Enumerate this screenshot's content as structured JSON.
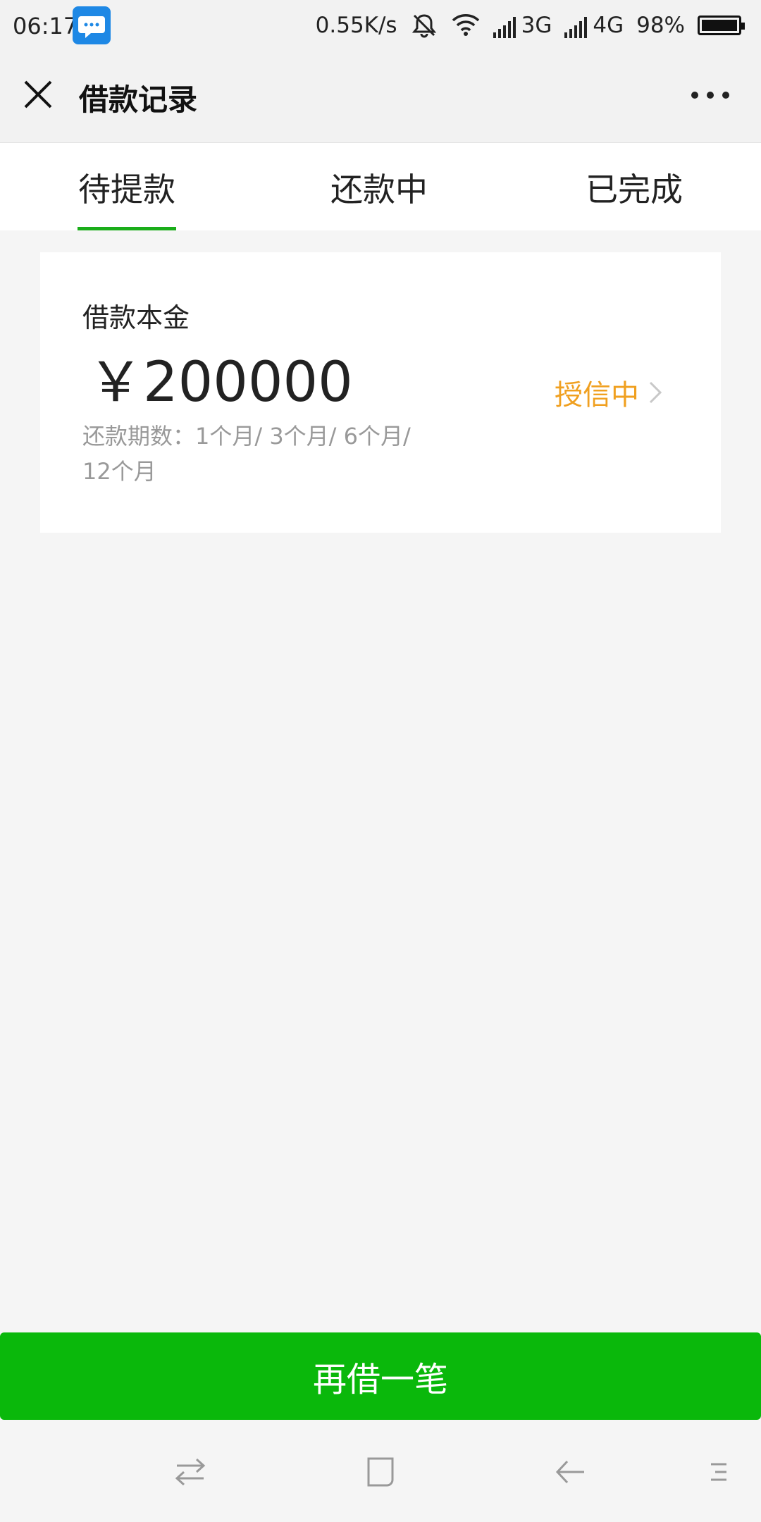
{
  "status_bar": {
    "time": "06:17",
    "speed": "0.55K/s",
    "network_3g": "3G",
    "network_4g": "4G",
    "battery": "98%"
  },
  "title_bar": {
    "title": "借款记录"
  },
  "tabs": [
    {
      "label": "待提款",
      "active": true
    },
    {
      "label": "还款中",
      "active": false
    },
    {
      "label": "已完成",
      "active": false
    }
  ],
  "loan_card": {
    "label": "借款本金",
    "amount": "￥200000",
    "terms_line1": "还款期数：1个月/ 3个月/ 6个月/",
    "terms_line2": "12个月",
    "status": "授信中"
  },
  "bottom_button": {
    "label": "再借一笔"
  },
  "colors": {
    "accent_green": "#1aad19",
    "button_green": "#0ab80b",
    "status_orange": "#f0a020"
  },
  "icons": {
    "message": "message-icon",
    "mute": "bell-off-icon",
    "wifi": "wifi-icon",
    "signal": "signal-icon",
    "battery": "battery-icon",
    "close": "close-icon",
    "more": "more-icon",
    "chevron": "chevron-right-icon",
    "nav_switch": "switch-arrows-icon",
    "nav_home": "home-square-icon",
    "nav_back": "back-arrow-icon",
    "nav_menu": "menu-icon"
  }
}
